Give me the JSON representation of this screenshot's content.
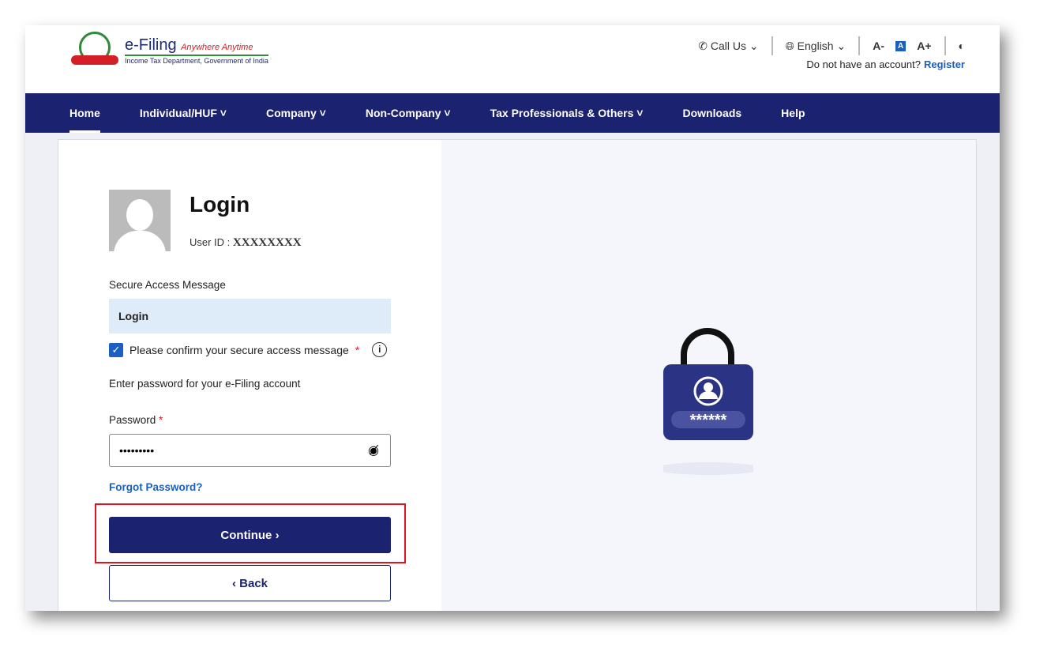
{
  "header": {
    "brand": "e-Filing",
    "tagline": "Anywhere Anytime",
    "dept": "Income Tax Department, Government of India",
    "call_us": "Call Us",
    "language": "English",
    "font_small": "A-",
    "font_normal": "A",
    "font_large": "A+",
    "no_account": "Do not have an account?",
    "register": "Register"
  },
  "nav": [
    "Home",
    "Individual/HUF",
    "Company",
    "Non-Company",
    "Tax Professionals & Others",
    "Downloads",
    "Help"
  ],
  "login": {
    "title": "Login",
    "user_id_label": "User ID :",
    "user_id_value": "XXXXXXXX",
    "secure_msg_label": "Secure Access Message",
    "secure_msg_value": "Login",
    "confirm_label": "Please confirm your secure access message",
    "confirm_checked": true,
    "password_hint": "Enter password for your e-Filing account",
    "password_label": "Password",
    "password_value": "•••••••••",
    "forgot": "Forgot Password?",
    "continue": "Continue",
    "back": "Back",
    "lock_mask": "******"
  },
  "colors": {
    "nav": "#1b2370",
    "accent": "#1b5fc1",
    "highlight": "#e0141e"
  }
}
